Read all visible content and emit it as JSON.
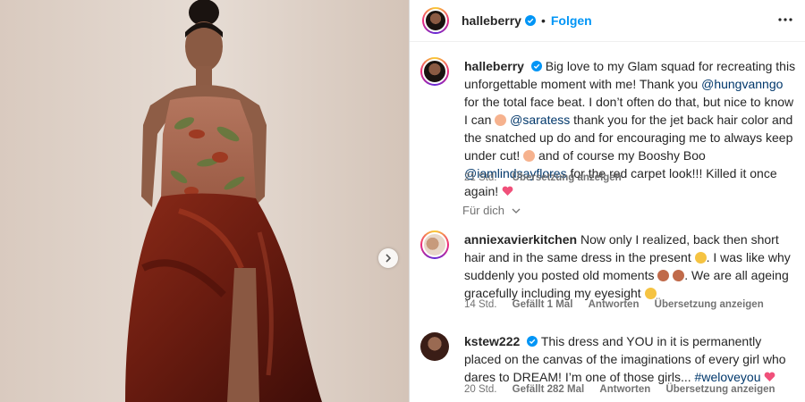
{
  "post": {
    "username": "halleberry",
    "follow_label": "Folgen",
    "dot": "•"
  },
  "caption": {
    "username": "halleberry",
    "text_1": "Big love to my Glam squad for recreating this unforgettable moment with me! Thank you ",
    "mention_1": "@hungvanngo",
    "text_2": " for the total face beat. I don’t often do that, but nice to know I can ",
    "mention_2": "@saratess",
    "text_3": " thank you for the jet back hair color and the snatched up do and for encouraging me to always keep under cut! ",
    "text_4": " and of course my Booshy Boo ",
    "mention_3": "@iamlindsayflores",
    "text_5": " for the red carpet look!!! Killed it once again! ",
    "time": "21 Std.",
    "translate": "Übersetzung anzeigen"
  },
  "sort_label": "Für dich",
  "comments": [
    {
      "username": "anniexavierkitchen",
      "text_1": "Now only I realized, back then short hair and in the same dress in the present ",
      "text_2": ". I was like why suddenly you posted old moments ",
      "text_3": ". We are all ageing gracefully including my eyesight ",
      "time": "14 Std.",
      "likes": "Gefällt 1 Mal",
      "reply": "Antworten",
      "translate": "Übersetzung anzeigen"
    },
    {
      "username": "kstew222",
      "text_1": "This dress and YOU in it is permanently placed on the canvas of the imaginations of every girl who dares to DREAM! I’m one of those girls... ",
      "hashtag": "#weloveyou",
      "time": "20 Std.",
      "likes": "Gefällt 282 Mal",
      "reply": "Antworten",
      "translate": "Übersetzung anzeigen"
    }
  ],
  "icons": {
    "verified": "verified-badge-icon",
    "more": "more-options-icon",
    "chevron": "chevron-down-icon",
    "next": "chevron-right-icon"
  },
  "colors": {
    "link": "#00376b",
    "follow": "#0095f6",
    "verified": "#0095f6",
    "meta": "#737373"
  }
}
